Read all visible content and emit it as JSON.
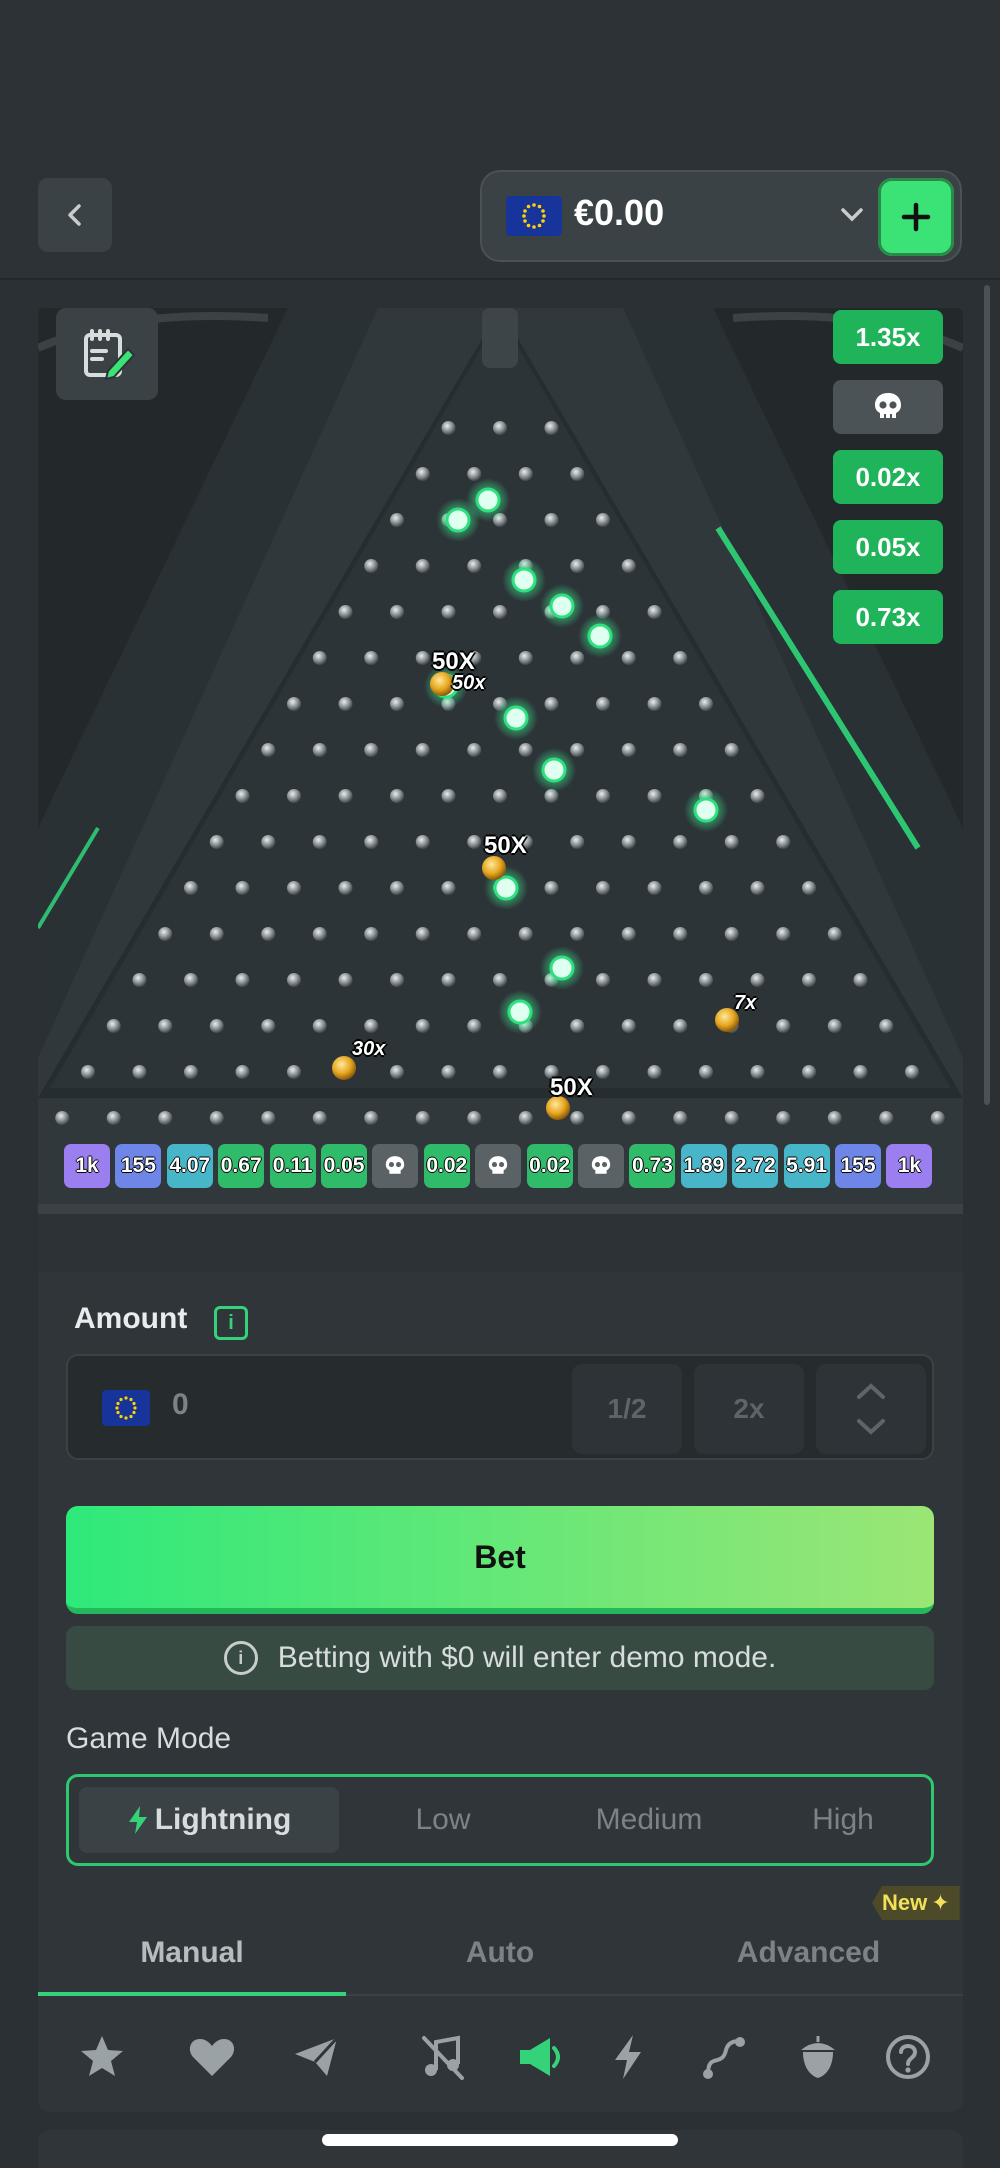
{
  "header": {
    "balance": "€0.00",
    "back_icon": "chevron-left-icon",
    "add_icon": "plus-icon",
    "currency_flag": "eu-flag-icon"
  },
  "history": {
    "items": [
      {
        "label": "1.35x",
        "kind": "value"
      },
      {
        "label": "",
        "kind": "skull"
      },
      {
        "label": "0.02x",
        "kind": "value"
      },
      {
        "label": "0.05x",
        "kind": "value"
      },
      {
        "label": "0.73x",
        "kind": "value"
      }
    ]
  },
  "board": {
    "ball_labels": [
      "50X",
      "50x",
      "50X",
      "7x",
      "30x",
      "50X"
    ],
    "slots": [
      {
        "label": "1k",
        "color": "#9b7ff0"
      },
      {
        "label": "155",
        "color": "#6d86e8"
      },
      {
        "label": "4.07",
        "color": "#47b6c9"
      },
      {
        "label": "0.67",
        "color": "#2fbb6a"
      },
      {
        "label": "0.11",
        "color": "#2fbb6a"
      },
      {
        "label": "0.05",
        "color": "#2fbb6a"
      },
      {
        "label": "",
        "color": "#5a6266"
      },
      {
        "label": "0.02",
        "color": "#2fbb6a"
      },
      {
        "label": "",
        "color": "#5a6266"
      },
      {
        "label": "0.02",
        "color": "#2fbb6a"
      },
      {
        "label": "",
        "color": "#5a6266"
      },
      {
        "label": "0.73",
        "color": "#2fbb6a"
      },
      {
        "label": "1.89",
        "color": "#47b6c9"
      },
      {
        "label": "2.72",
        "color": "#47b6c9"
      },
      {
        "label": "5.91",
        "color": "#47b6c9"
      },
      {
        "label": "155",
        "color": "#6d86e8"
      },
      {
        "label": "1k",
        "color": "#9b7ff0"
      }
    ]
  },
  "amount": {
    "label": "Amount",
    "value": "0",
    "half": "1/2",
    "double": "2x"
  },
  "bet": {
    "label": "Bet",
    "demo_note": "Betting with $0 will enter demo mode."
  },
  "game_mode": {
    "label": "Game Mode",
    "options": [
      "Lightning",
      "Low",
      "Medium",
      "High"
    ],
    "selected": "Lightning"
  },
  "tabs": {
    "items": [
      "Manual",
      "Auto",
      "Advanced"
    ],
    "active": "Manual",
    "new_badge": "New"
  },
  "toolbar_icons": [
    "star-icon",
    "heart-icon",
    "send-icon",
    "music-off-icon",
    "megaphone-icon",
    "lightning-icon",
    "route-icon",
    "acorn-icon",
    "help-icon"
  ],
  "colors": {
    "accent": "#34d279",
    "background": "#2a3033",
    "board": "#23292b"
  }
}
